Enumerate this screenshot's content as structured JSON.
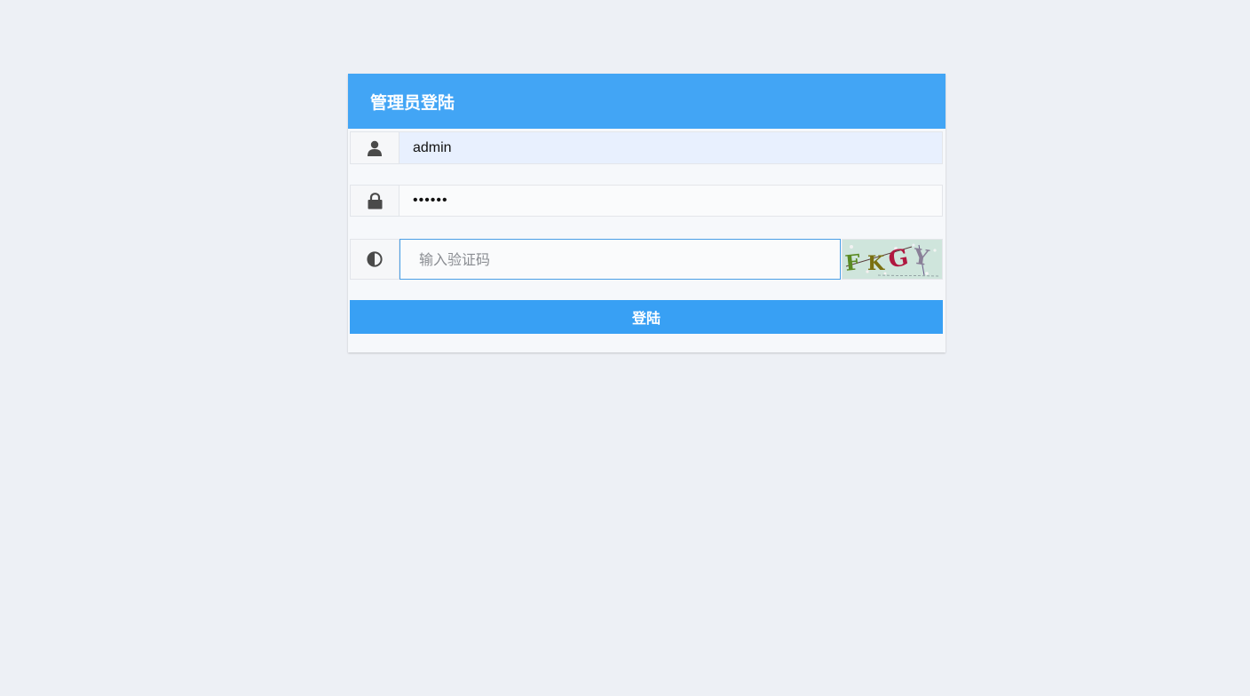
{
  "panel": {
    "title": "管理员登陆"
  },
  "username": {
    "value": "admin",
    "icon": "user-icon"
  },
  "password": {
    "value": "••••••",
    "icon": "lock-icon"
  },
  "captcha": {
    "placeholder": "输入验证码",
    "icon": "half-circle-icon",
    "image_text": "FKGY"
  },
  "login_button": {
    "label": "登陆"
  },
  "colors": {
    "background": "#edf0f5",
    "header": "#42a5f5",
    "button": "#38a0f4",
    "focus_border": "#4a9fe6"
  }
}
